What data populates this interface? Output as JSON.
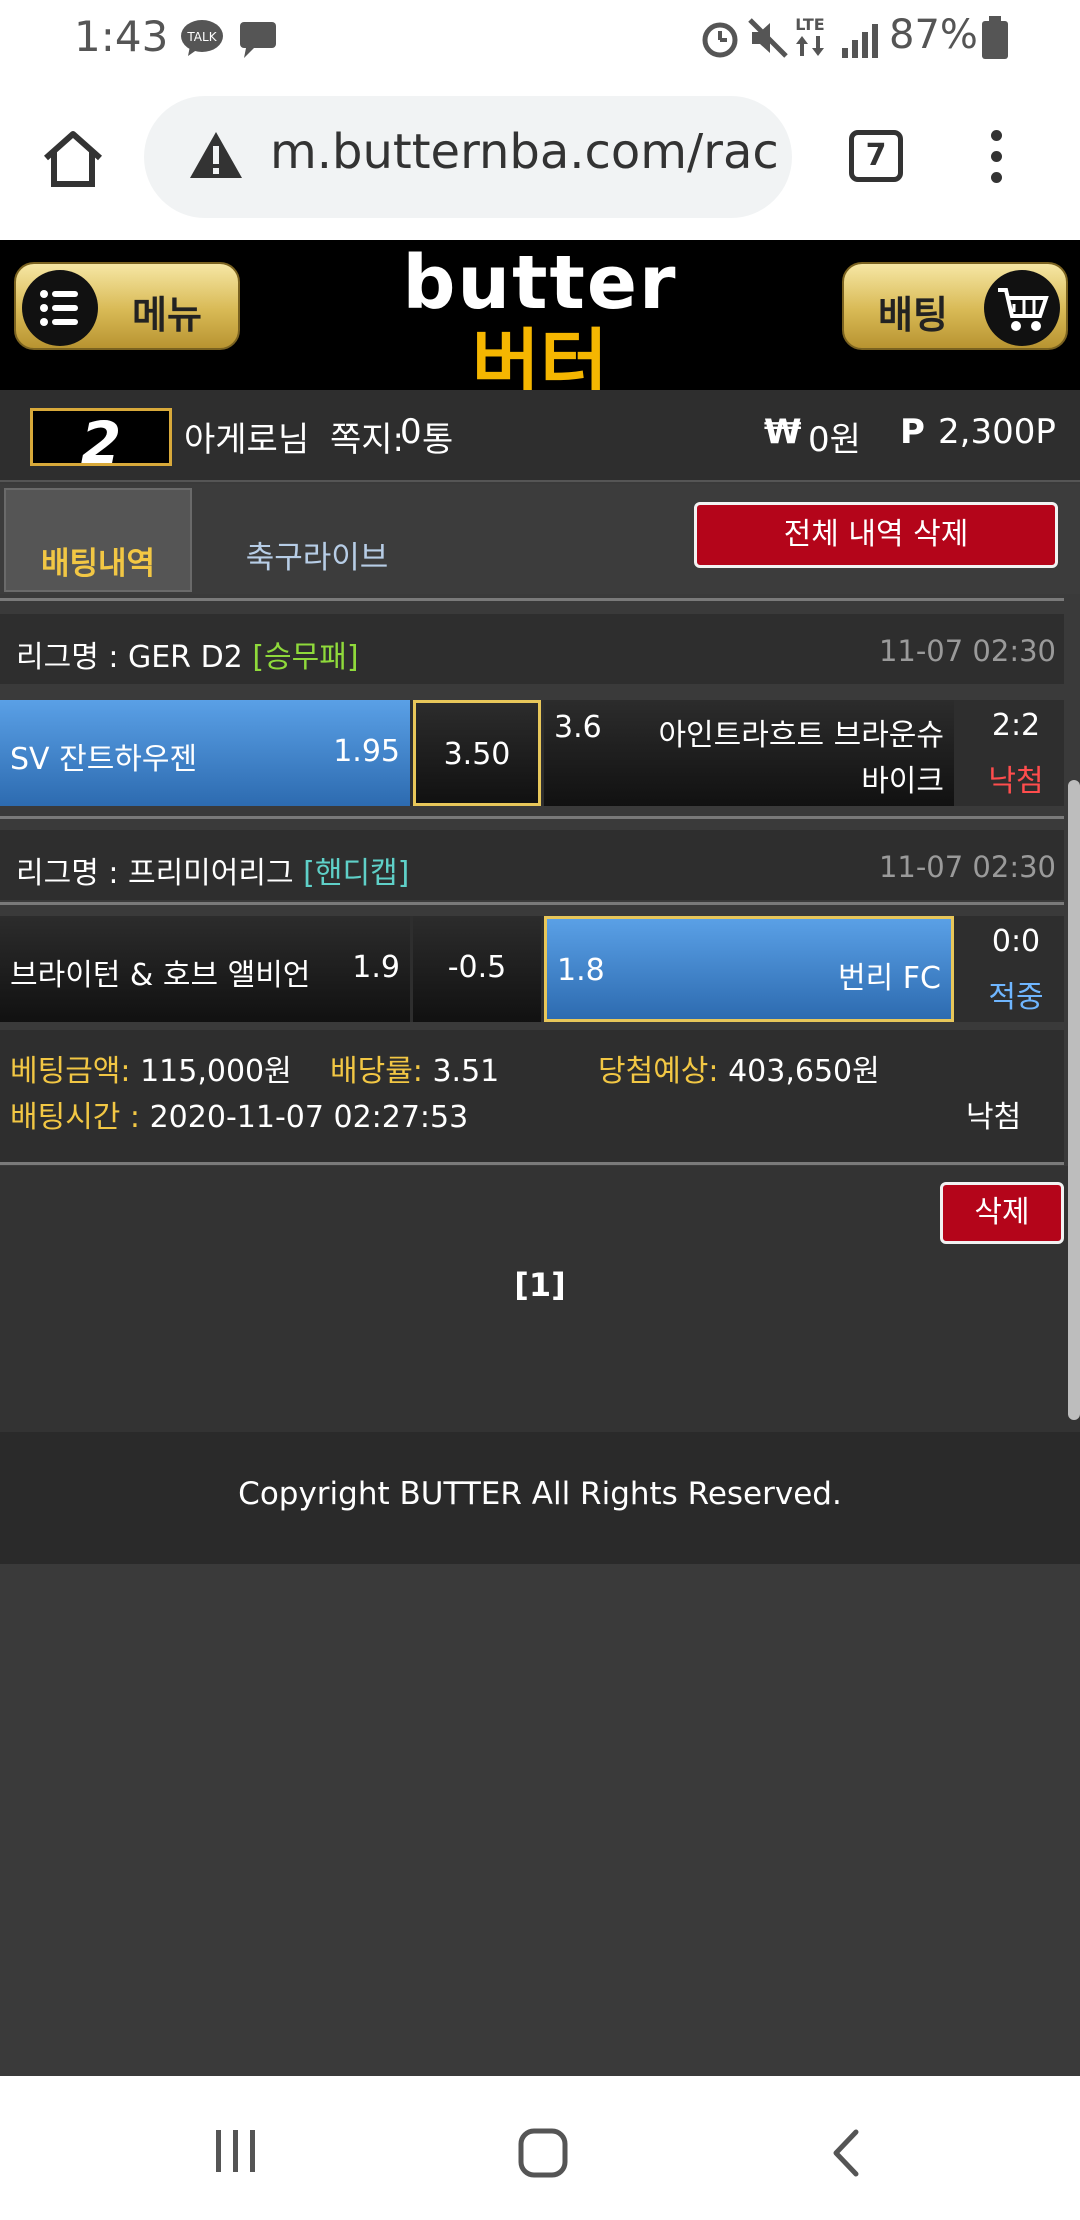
{
  "status_bar": {
    "time": "1:43",
    "icons": [
      "kakaotalk-icon",
      "message-icon",
      "alarm-icon",
      "mute-icon",
      "lte-icon",
      "signal-icon",
      "battery-icon"
    ],
    "lte_label": "LTE",
    "talk_label": "TALK",
    "battery_percent": "87%"
  },
  "browser": {
    "url": "m.butternba.com/rac",
    "tab_count": "7"
  },
  "site_header": {
    "menu_label": "메뉴",
    "logo_en": "butter",
    "logo_ko": "버터",
    "bet_label": "배팅"
  },
  "user": {
    "level": "2",
    "name": "아게로",
    "name_suffix": "님",
    "memo_label": "쪽지:",
    "memo_count": "0",
    "memo_unit": "통",
    "won_symbol": "₩",
    "balance": "0원",
    "points_symbol": "P",
    "points": "2,300P"
  },
  "tabs": {
    "active": "배팅내역",
    "other": "축구라이브",
    "delete_all": "전체 내역 삭제"
  },
  "bets": [
    {
      "league_label": "리그명 : GER D2",
      "league_type": "[승무패]",
      "date": "11-07 02:30",
      "home": "SV 잔트하우젠",
      "home_odds": "1.95",
      "middle": "3.50",
      "away_odds": "3.6",
      "away_line1": "아인트라흐트 브라운슈",
      "away_line2": "바이크",
      "score": "2:2",
      "result": "낙첨"
    },
    {
      "league_label": "리그명 : 프리미어리그",
      "league_type": "[핸디캡]",
      "date": "11-07 02:30",
      "home": "브라이턴 & 호브 앨비언",
      "home_odds": "1.9",
      "middle": "-0.5",
      "away_odds": "1.8",
      "away": "번리 FC",
      "score": "0:0",
      "result": "적중"
    }
  ],
  "summary": {
    "amount_label": "베팅금액:",
    "amount": "115,000원",
    "rate_label": "배당률:",
    "rate": "3.51",
    "expected_label": "당첨예상:",
    "expected": "403,650원",
    "time_label": "배팅시간 :",
    "time": "2020-11-07 02:27:53",
    "result": "낙첨",
    "delete": "삭제"
  },
  "pager": "[1]",
  "footer": "Copyright BUTTER All Rights Reserved.",
  "colors": {
    "gold": "#f2c744",
    "red_button": "#b4051a",
    "blue_selected": "#2d6bb0",
    "win_blue": "#6fb6ff",
    "lose_red": "#ff4d4d"
  }
}
